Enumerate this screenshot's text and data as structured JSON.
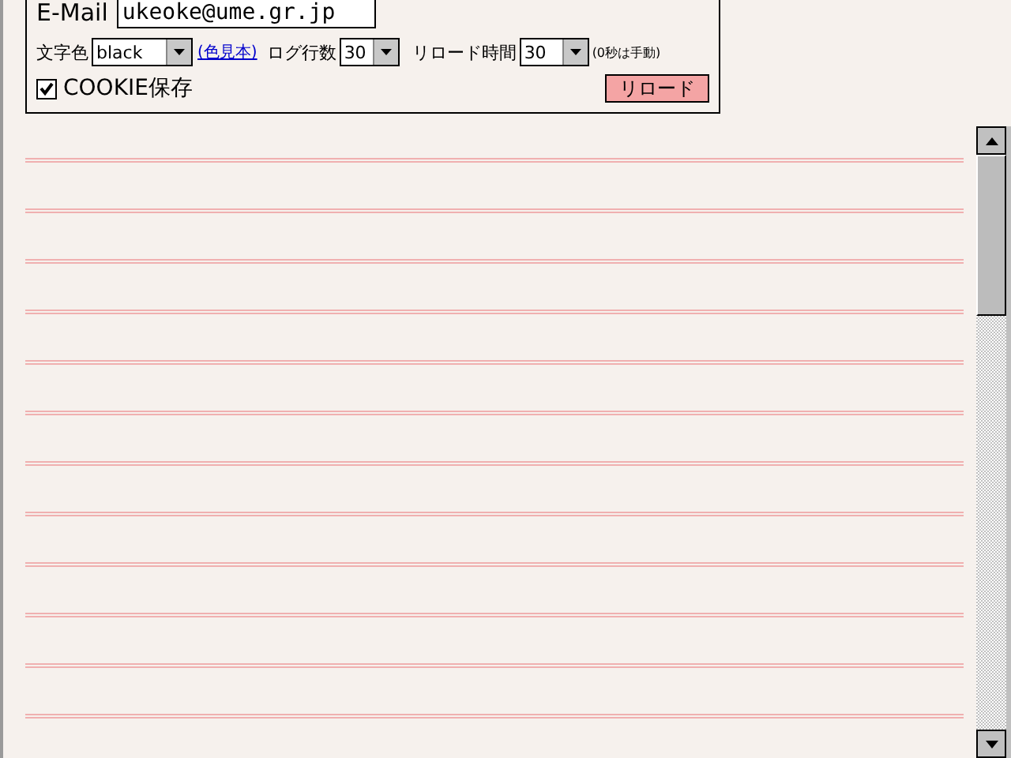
{
  "form": {
    "email": {
      "label": "E-Mail",
      "value": "ukeoke@ume.gr.jp"
    },
    "text_color": {
      "label": "文字色",
      "value": "black"
    },
    "color_sample_link": "(色見本)",
    "log_lines": {
      "label": "ログ行数",
      "value": "30"
    },
    "reload_time": {
      "label": "リロード時間",
      "value": "30"
    },
    "reload_note": "(0秒は手動)",
    "cookie": {
      "label": "COOKIE保存",
      "checked": true
    },
    "reload_button": "リロード"
  }
}
